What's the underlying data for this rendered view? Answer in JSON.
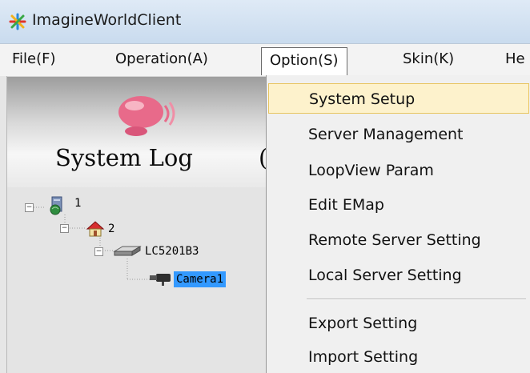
{
  "window": {
    "title": "ImagineWorldClient"
  },
  "menubar": {
    "items": [
      {
        "label": "File(F)"
      },
      {
        "label": "Operation(A)"
      },
      {
        "label": "Option(S)"
      },
      {
        "label": "Skin(K)"
      },
      {
        "label": "He"
      }
    ]
  },
  "banner": {
    "title": "System Log",
    "next_partial": "("
  },
  "tree": {
    "nodes": [
      {
        "label": "1"
      },
      {
        "label": "2"
      },
      {
        "label": "LC5201B3"
      },
      {
        "label": "Camera1"
      }
    ],
    "expander_symbol": "−"
  },
  "option_menu": {
    "items": [
      {
        "label": "System Setup"
      },
      {
        "label": "Server Management"
      },
      {
        "label": "LoopView Param"
      },
      {
        "label": "Edit EMap"
      },
      {
        "label": "Remote Server Setting"
      },
      {
        "label": "Local Server Setting"
      },
      {
        "label": "Export Setting"
      },
      {
        "label": "Import Setting"
      }
    ]
  },
  "colors": {
    "selection": "#3399ff",
    "menu_highlight": "#fdf2cc",
    "balloon": "#e86a8a"
  }
}
